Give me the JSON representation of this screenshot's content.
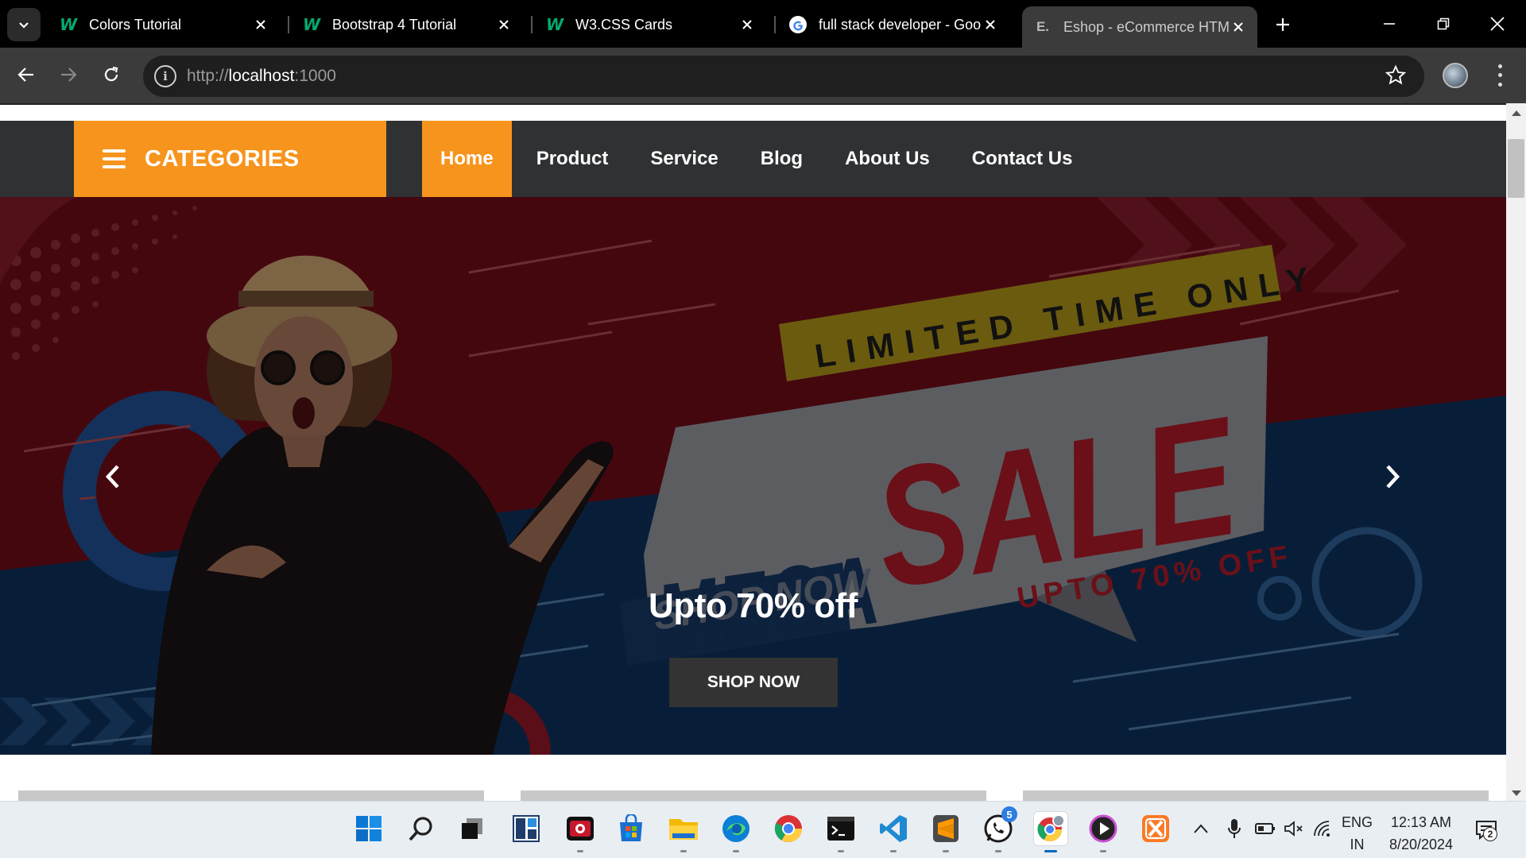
{
  "browser": {
    "tabs": [
      {
        "title": "Colors Tutorial",
        "favicon": "w3schools-icon",
        "active": false
      },
      {
        "title": "Bootstrap 4 Tutorial",
        "favicon": "w3schools-icon",
        "active": false
      },
      {
        "title": "W3.CSS Cards",
        "favicon": "w3schools-icon",
        "active": false
      },
      {
        "title": "full stack developer - Goo",
        "favicon": "google-icon",
        "active": false
      },
      {
        "title": "Eshop - eCommerce HTM",
        "favicon": "eshop-icon",
        "active": true
      }
    ],
    "url_scheme": "http://",
    "url_host": "localhost",
    "url_port": ":1000"
  },
  "site": {
    "categories_label": "CATEGORIES",
    "menu": [
      {
        "label": "Home",
        "active": true
      },
      {
        "label": "Product",
        "active": false
      },
      {
        "label": "Service",
        "active": false
      },
      {
        "label": "Blog",
        "active": false
      },
      {
        "label": "About Us",
        "active": false
      },
      {
        "label": "Contact Us",
        "active": false
      }
    ],
    "accent_color": "#f7941d",
    "nav_bg_color": "#2f3133"
  },
  "hero": {
    "banner_ribbon": "LIMITED TIME ONLY",
    "banner_mega": "MEGA",
    "banner_sale": "SALE",
    "banner_upto": "UPTO 70% OFF",
    "banner_shopnow": "SHOP NOW",
    "caption": "Upto 70% off",
    "button_label": "SHOP NOW"
  },
  "taskbar": {
    "icons": [
      "windows-start-icon",
      "search-icon",
      "task-view-icon",
      "widgets-icon",
      "screen-recorder-icon",
      "microsoft-store-icon",
      "file-explorer-icon",
      "edge-icon",
      "chrome-icon",
      "terminal-icon",
      "vscode-icon",
      "sublime-text-icon",
      "whatsapp-icon",
      "chrome-profile-icon",
      "media-player-icon",
      "xampp-icon"
    ],
    "whatsapp_badge": "5",
    "language_line1": "ENG",
    "language_line2": "IN",
    "time": "12:13 AM",
    "date": "8/20/2024",
    "notification_count": "2"
  }
}
